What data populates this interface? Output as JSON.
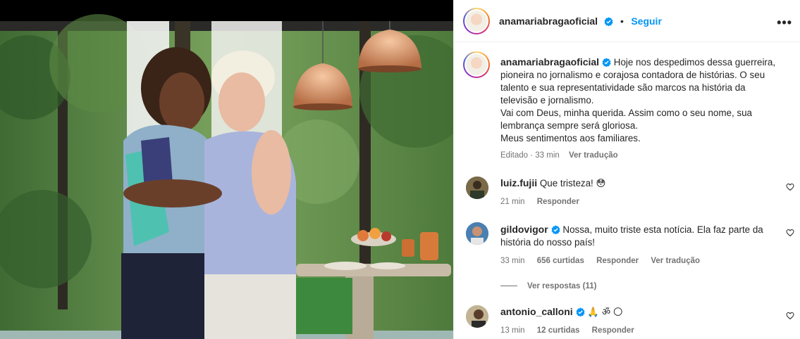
{
  "post": {
    "photo_alt": "Duas mulheres se abraçando",
    "author": "anamariabragaoficial",
    "follow_label": "Seguir",
    "separator": "•",
    "more_label": "•••",
    "caption_lines": [
      "Hoje nos despedimos dessa guerreira,",
      "pioneira no jornalismo e corajosa contadora de histórias. O seu",
      "talento e sua representatividade são marcos na história da",
      "televisão e jornalismo.",
      "Vai com Deus, minha querida. Assim como o seu nome, sua",
      "lembrança sempre será gloriosa.",
      "Meus sentimentos aos familiares."
    ],
    "edited_label": "Editado",
    "time": "33 min",
    "translate_label": "Ver tradução"
  },
  "comments": [
    {
      "user": "luiz.fujii",
      "verified": false,
      "text": "Que tristeza!",
      "emoji": "😳",
      "time": "21 min",
      "likes": "",
      "reply_label": "Responder",
      "translate_label": ""
    },
    {
      "user": "gildovigor",
      "verified": true,
      "text_line1": "Nossa, muito triste esta notícia. Ela faz parte da",
      "text_line2": "história do nosso país!",
      "time": "33 min",
      "likes": "656 curtidas",
      "reply_label": "Responder",
      "translate_label": "Ver tradução",
      "replies_label": "Ver respostas (11)"
    },
    {
      "user": "antonio_calloni",
      "verified": true,
      "emoji": "🙏 ॐ 🌕",
      "time": "13 min",
      "likes": "12 curtidas",
      "reply_label": "Responder"
    }
  ],
  "colors": {
    "link_blue": "#0095f6",
    "verified_blue": "#0095f6",
    "secondary_text": "#737373"
  }
}
